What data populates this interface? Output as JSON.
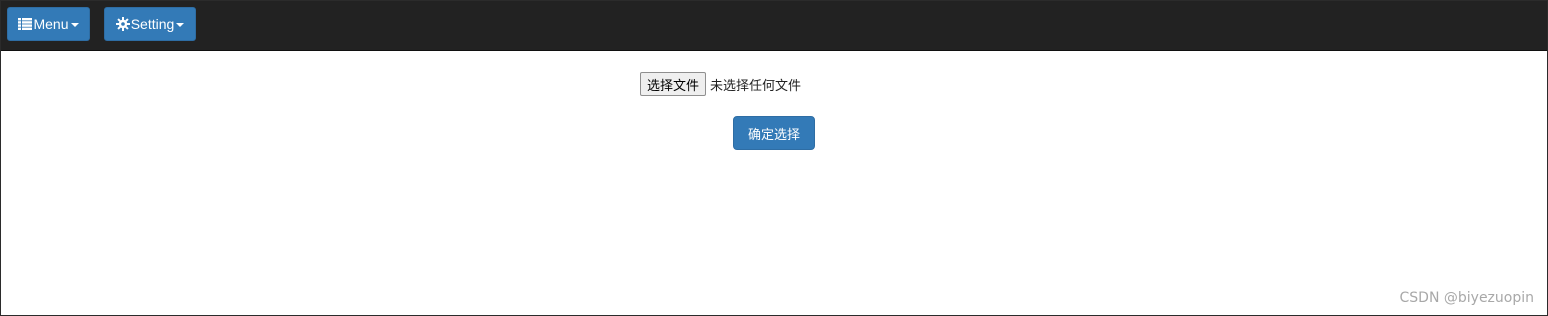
{
  "navbar": {
    "background": "#222222",
    "menu_button": {
      "label": "Menu",
      "icon": "list-icon",
      "color": "#337ab7"
    },
    "setting_button": {
      "label": "Setting",
      "icon": "gear-icon",
      "color": "#337ab7"
    }
  },
  "upload": {
    "file_button_label": "选择文件",
    "file_status": "未选择任何文件",
    "confirm_label": "确定选择"
  },
  "watermark": "CSDN @biyezuopin"
}
